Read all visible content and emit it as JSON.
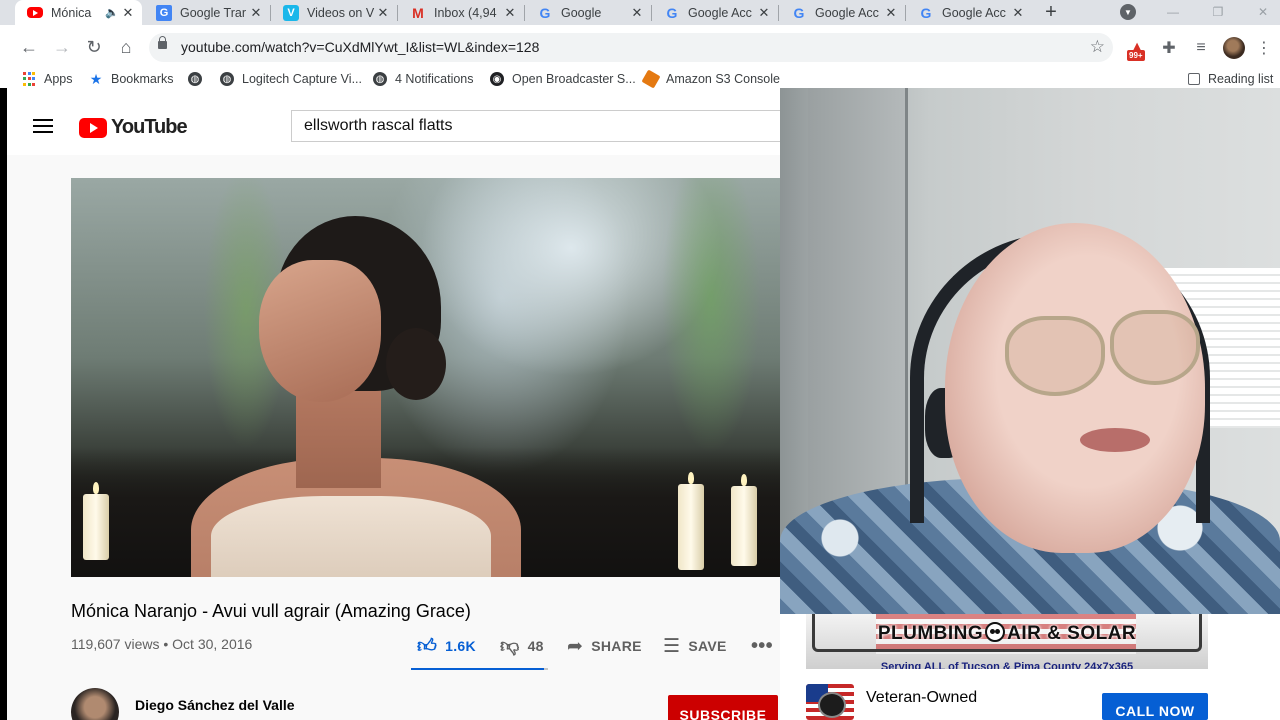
{
  "browser": {
    "tabs": [
      {
        "title": "Mónica",
        "favicon": "youtube-icon",
        "active": true,
        "audio": true
      },
      {
        "title": "Google Trar",
        "favicon": "google-translate-icon"
      },
      {
        "title": "Videos on V",
        "favicon": "vimeo-icon"
      },
      {
        "title": "Inbox (4,94",
        "favicon": "gmail-icon"
      },
      {
        "title": "Google",
        "favicon": "google-icon"
      },
      {
        "title": "Google Acc",
        "favicon": "google-icon"
      },
      {
        "title": "Google Acc",
        "favicon": "google-icon"
      },
      {
        "title": "Google Acc",
        "favicon": "google-icon"
      }
    ],
    "address": {
      "url": "youtube.com/watch?v=CuXdMlYwt_I&list=WL&index=128"
    },
    "extension_badge": "99+",
    "bookmarks": [
      {
        "label": "Apps",
        "icon": "apps-grid-icon"
      },
      {
        "label": "Bookmarks",
        "icon": "star-icon"
      },
      {
        "label": "",
        "icon": "globe-icon"
      },
      {
        "label": "Logitech Capture Vi...",
        "icon": "globe-icon"
      },
      {
        "label": "4 Notifications",
        "icon": "globe-icon"
      },
      {
        "label": "Open Broadcaster S...",
        "icon": "obs-icon"
      },
      {
        "label": "Amazon S3 Console",
        "icon": "aws-icon"
      }
    ],
    "reading_list": "Reading list"
  },
  "youtube": {
    "logo_text": "YouTube",
    "search_value": "ellsworth rascal flatts",
    "video": {
      "title": "Mónica Naranjo - Avui vull agrair (Amazing Grace)",
      "meta": "119,607 views • Oct 30, 2016",
      "likes": "1.6K",
      "dislikes": "48",
      "like_ratio": 0.97,
      "share_label": "SHARE",
      "save_label": "SAVE",
      "more_label": "•••"
    },
    "channel": {
      "name": "Diego Sánchez del Valle",
      "subscribe_label": "SUBSCRIBE"
    }
  },
  "ad": {
    "banner_brand_left": "PLUMBING",
    "banner_brand_right": "AIR & SOLAR",
    "banner_tagline": "Serving ALL of Tucson & Pima County 24x7x365",
    "text": "Veteran-Owned",
    "cta": "CALL NOW"
  },
  "colors": {
    "youtube_red": "#ff0000",
    "link_blue": "#065fd4",
    "subscribe_red": "#cc0000"
  }
}
